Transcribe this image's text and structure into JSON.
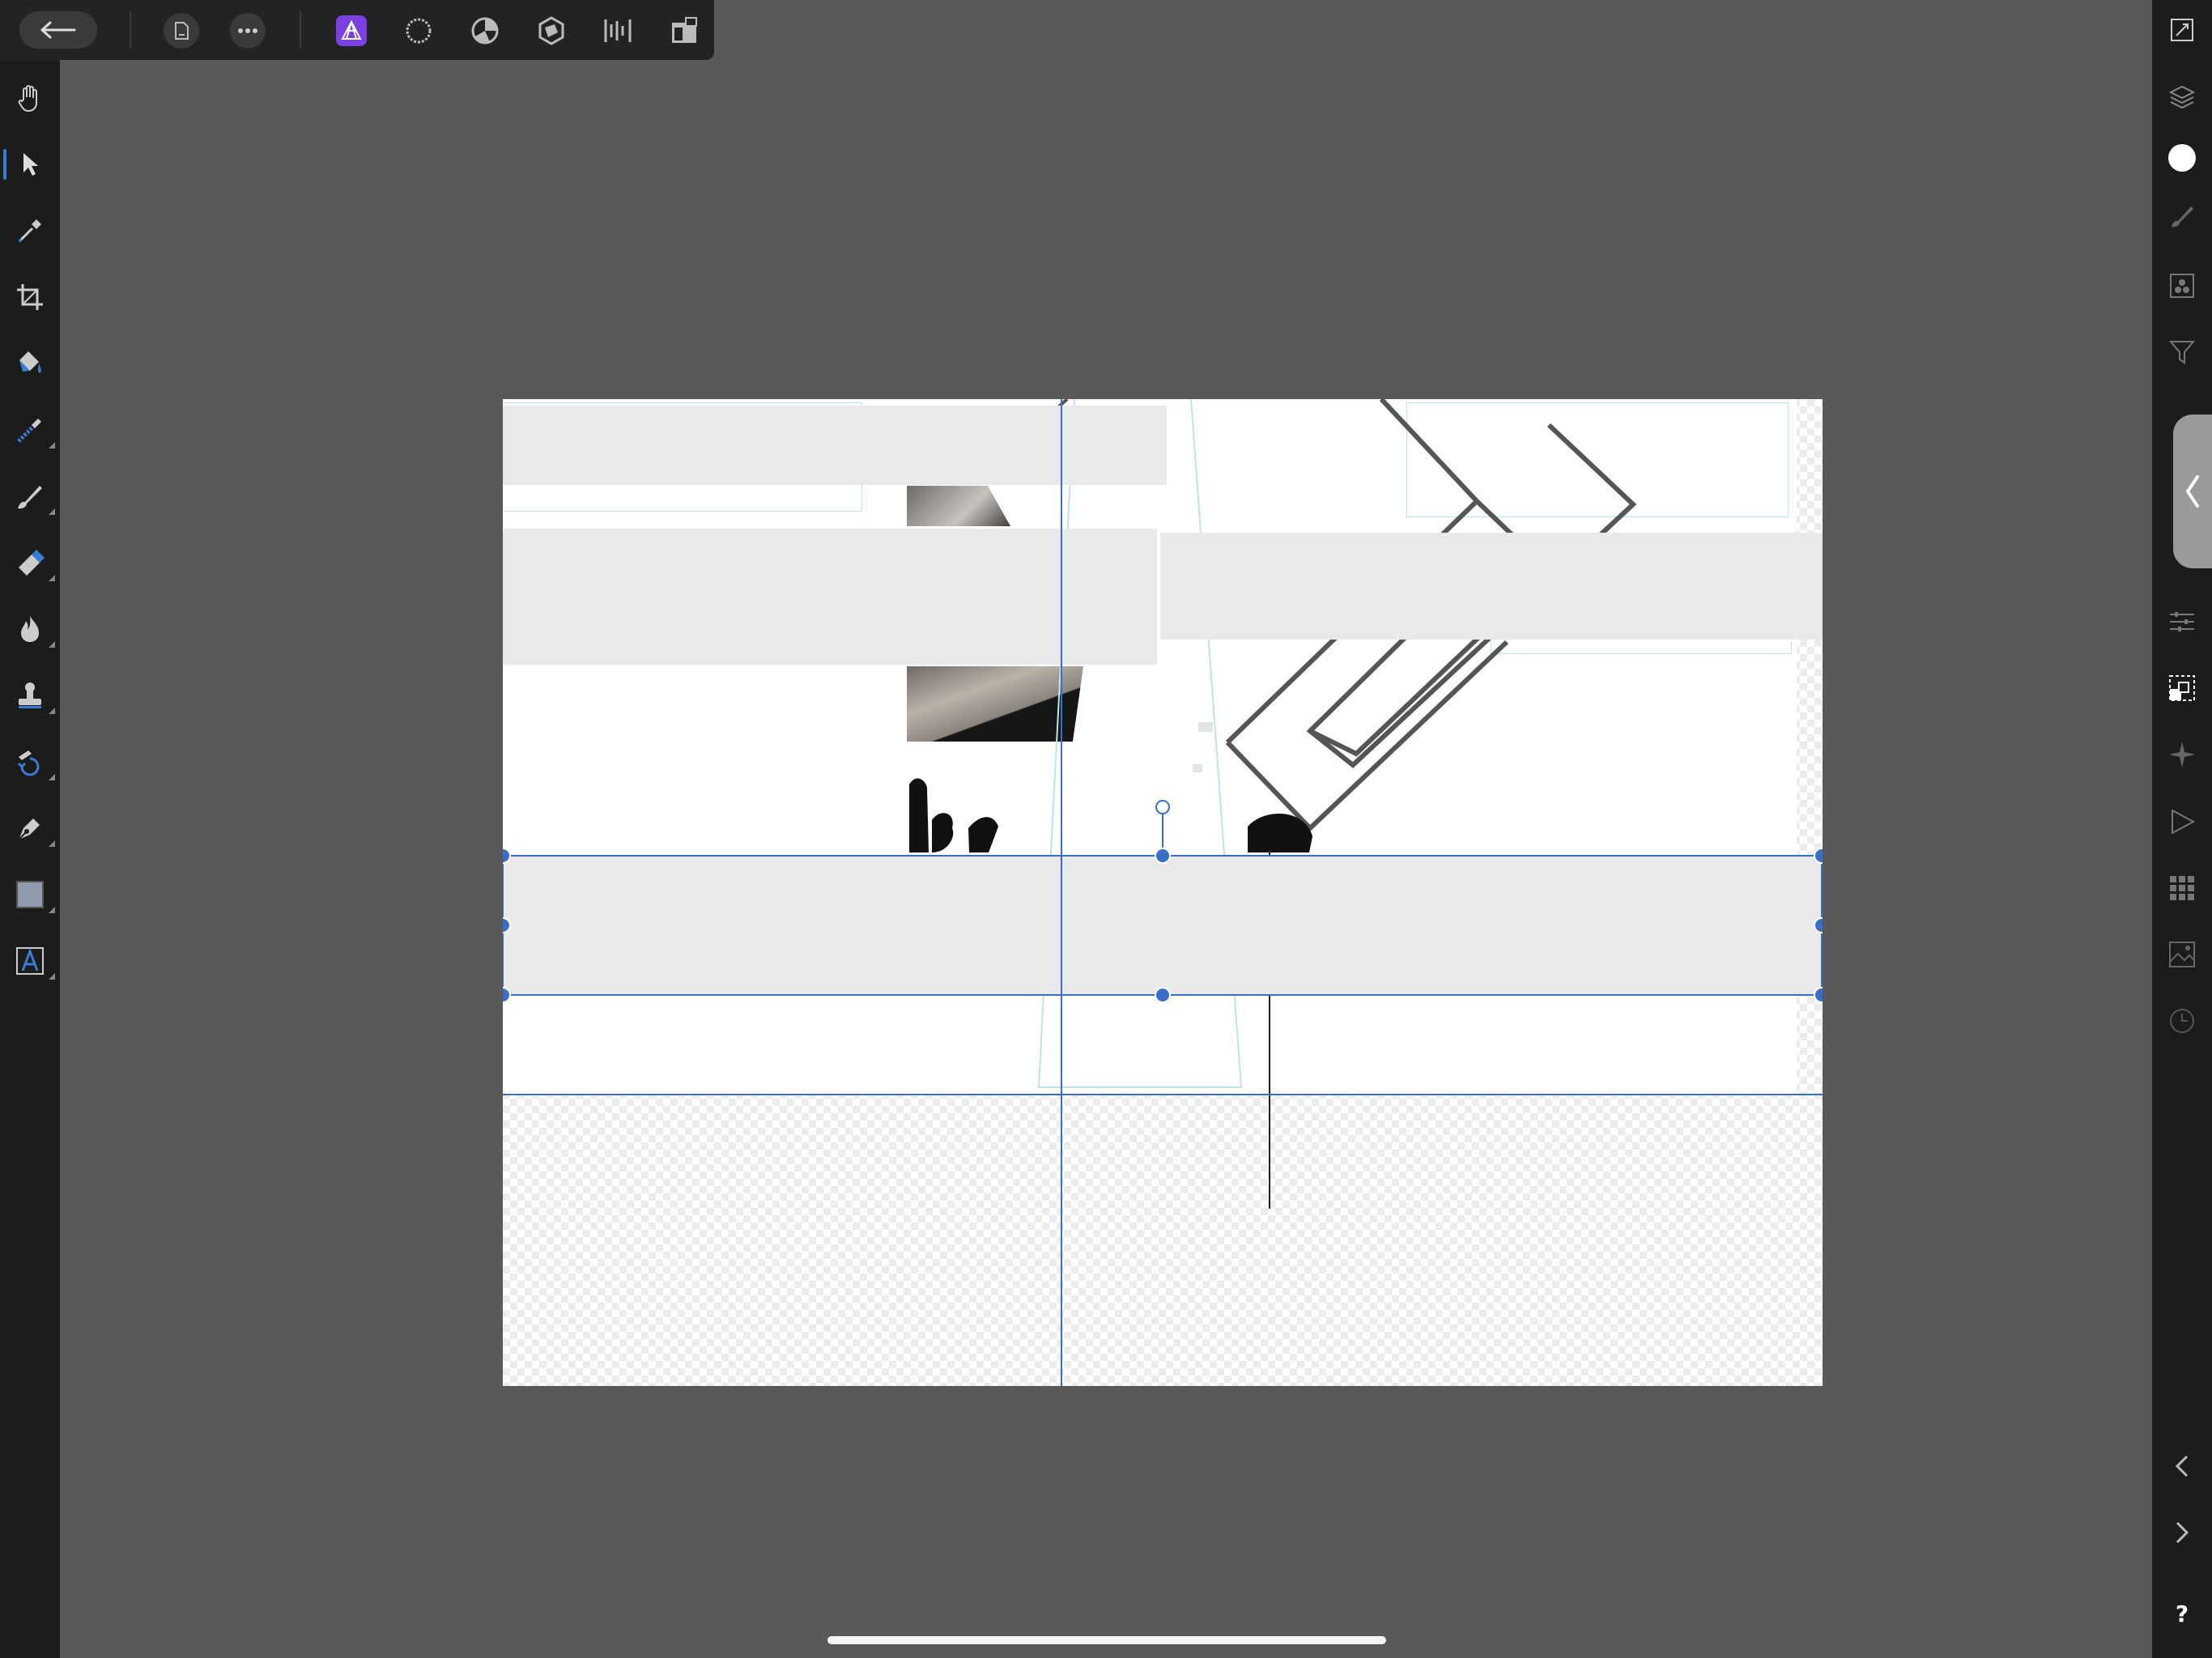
{
  "app": "Affinity Photo",
  "top_toolbar": {
    "back": "back-arrow-icon",
    "buttons": [
      "document-icon",
      "more-icon"
    ],
    "personas": [
      "photo-persona-icon",
      "liquify-persona-icon",
      "develop-persona-icon",
      "tone-mapping-persona-icon",
      "export-persona-icon",
      "layout-persona-icon"
    ],
    "active_persona": "photo-persona-icon",
    "accent": "#7b3fe4"
  },
  "left_tools": [
    "hand-tool-icon",
    "move-tool-icon",
    "color-picker-tool-icon",
    "crop-tool-icon",
    "flood-fill-tool-icon",
    "selection-brush-tool-icon",
    "paint-brush-tool-icon",
    "erase-brush-tool-icon",
    "dodge-tool-icon",
    "clone-stamp-tool-icon",
    "inpainting-tool-icon",
    "pen-tool-icon",
    "rectangle-tool-icon",
    "text-tool-icon"
  ],
  "selected_tool": "move-tool-icon",
  "right_studios": [
    "canvas-size-icon",
    "layers-icon",
    "color-icon",
    "brushes-icon",
    "channels-icon",
    "filters-icon",
    "adjustments-icon",
    "transform-icon",
    "navigator-icon",
    "macro-icon",
    "library-icon",
    "stock-icon",
    "history-icon"
  ],
  "right_bottom": [
    "undo-chevron-icon",
    "redo-chevron-icon"
  ],
  "help_label": "?",
  "selection_color": "#3a6fc9"
}
